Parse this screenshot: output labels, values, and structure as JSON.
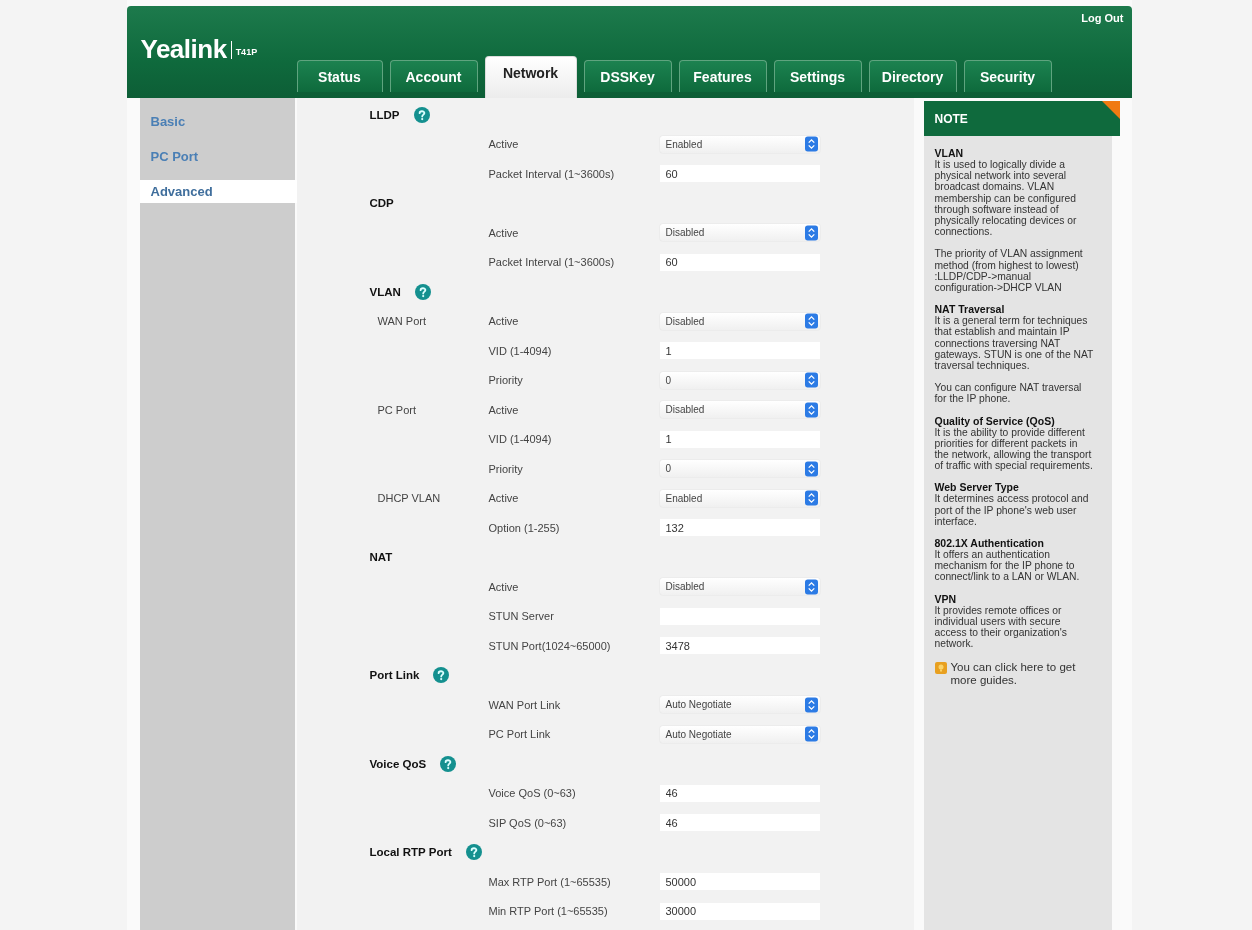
{
  "header": {
    "brand": "Yealink",
    "model": "T41P",
    "logout": "Log Out"
  },
  "tabs": [
    {
      "label": "Status",
      "selected": false
    },
    {
      "label": "Account",
      "selected": false
    },
    {
      "label": "Network",
      "selected": true
    },
    {
      "label": "DSSKey",
      "selected": false
    },
    {
      "label": "Features",
      "selected": false
    },
    {
      "label": "Settings",
      "selected": false
    },
    {
      "label": "Directory",
      "selected": false
    },
    {
      "label": "Security",
      "selected": false
    }
  ],
  "sidebar": {
    "items": [
      {
        "label": "Basic",
        "selected": false
      },
      {
        "label": "PC Port",
        "selected": false
      },
      {
        "label": "Advanced",
        "selected": true
      }
    ]
  },
  "sections": [
    {
      "title": "LLDP",
      "help": true,
      "rows": [
        {
          "label": "Active",
          "kind": "select",
          "value": "Enabled"
        },
        {
          "label": "Packet Interval (1~3600s)",
          "kind": "input",
          "value": "60"
        }
      ]
    },
    {
      "title": "CDP",
      "help": false,
      "rows": [
        {
          "label": "Active",
          "kind": "select",
          "value": "Disabled"
        },
        {
          "label": "Packet Interval (1~3600s)",
          "kind": "input",
          "value": "60"
        }
      ]
    },
    {
      "title": "VLAN",
      "help": true,
      "rows": [
        {
          "group": "WAN Port",
          "label": "Active",
          "kind": "select",
          "value": "Disabled"
        },
        {
          "label": "VID (1-4094)",
          "kind": "input",
          "value": "1"
        },
        {
          "label": "Priority",
          "kind": "select",
          "value": "0"
        },
        {
          "group": "PC Port",
          "label": "Active",
          "kind": "select",
          "value": "Disabled"
        },
        {
          "label": "VID (1-4094)",
          "kind": "input",
          "value": "1"
        },
        {
          "label": "Priority",
          "kind": "select",
          "value": "0"
        },
        {
          "group": "DHCP VLAN",
          "label": "Active",
          "kind": "select",
          "value": "Enabled"
        },
        {
          "label": "Option (1-255)",
          "kind": "input",
          "value": "132"
        }
      ]
    },
    {
      "title": "NAT",
      "help": false,
      "rows": [
        {
          "label": "Active",
          "kind": "select",
          "value": "Disabled"
        },
        {
          "label": "STUN Server",
          "kind": "input"
        },
        {
          "label": "STUN Port(1024~65000)",
          "kind": "input",
          "value": "3478"
        }
      ]
    },
    {
      "title": "Port Link",
      "help": true,
      "rows": [
        {
          "label": "WAN Port Link",
          "kind": "select",
          "value": "Auto Negotiate"
        },
        {
          "label": "PC Port Link",
          "kind": "select",
          "value": "Auto Negotiate"
        }
      ]
    },
    {
      "title": "Voice QoS",
      "help": true,
      "rows": [
        {
          "label": "Voice QoS (0~63)",
          "kind": "input",
          "value": "46"
        },
        {
          "label": "SIP QoS (0~63)",
          "kind": "input",
          "value": "46"
        }
      ]
    },
    {
      "title": "Local RTP Port",
      "help": true,
      "rows": [
        {
          "label": "Max RTP Port (1~65535)",
          "kind": "input",
          "value": "50000"
        },
        {
          "label": "Min RTP Port (1~65535)",
          "kind": "input",
          "value": "30000"
        }
      ]
    }
  ],
  "note": {
    "title": "NOTE",
    "entries": [
      {
        "title": "VLAN",
        "paragraphs": [
          "It is used to logically divide a physical network into several broadcast domains. VLAN membership can be configured through software instead of physically relocating devices or connections.",
          "The priority of VLAN assignment method (from highest to lowest) :LLDP/CDP->manual configuration->DHCP VLAN"
        ]
      },
      {
        "title": "NAT Traversal",
        "paragraphs": [
          "It is a general term for techniques that establish and maintain IP connections traversing NAT gateways. STUN is one of the NAT traversal techniques.",
          "You can configure NAT traversal for the IP phone."
        ]
      },
      {
        "title": "Quality of Service (QoS)",
        "paragraphs": [
          "It is the ability to provide different priorities for different packets in the network, allowing the transport of traffic with special requirements."
        ]
      },
      {
        "title": "Web Server Type",
        "paragraphs": [
          "It determines access protocol and port of the IP phone's web user interface."
        ]
      },
      {
        "title": "802.1X Authentication",
        "paragraphs": [
          "It offers an authentication mechanism for the IP phone to connect/link to a LAN or WLAN."
        ]
      },
      {
        "title": "VPN",
        "paragraphs": [
          "It provides remote offices or individual users with secure access to their organization's network."
        ]
      }
    ],
    "guide": "You can click here to get more guides."
  }
}
